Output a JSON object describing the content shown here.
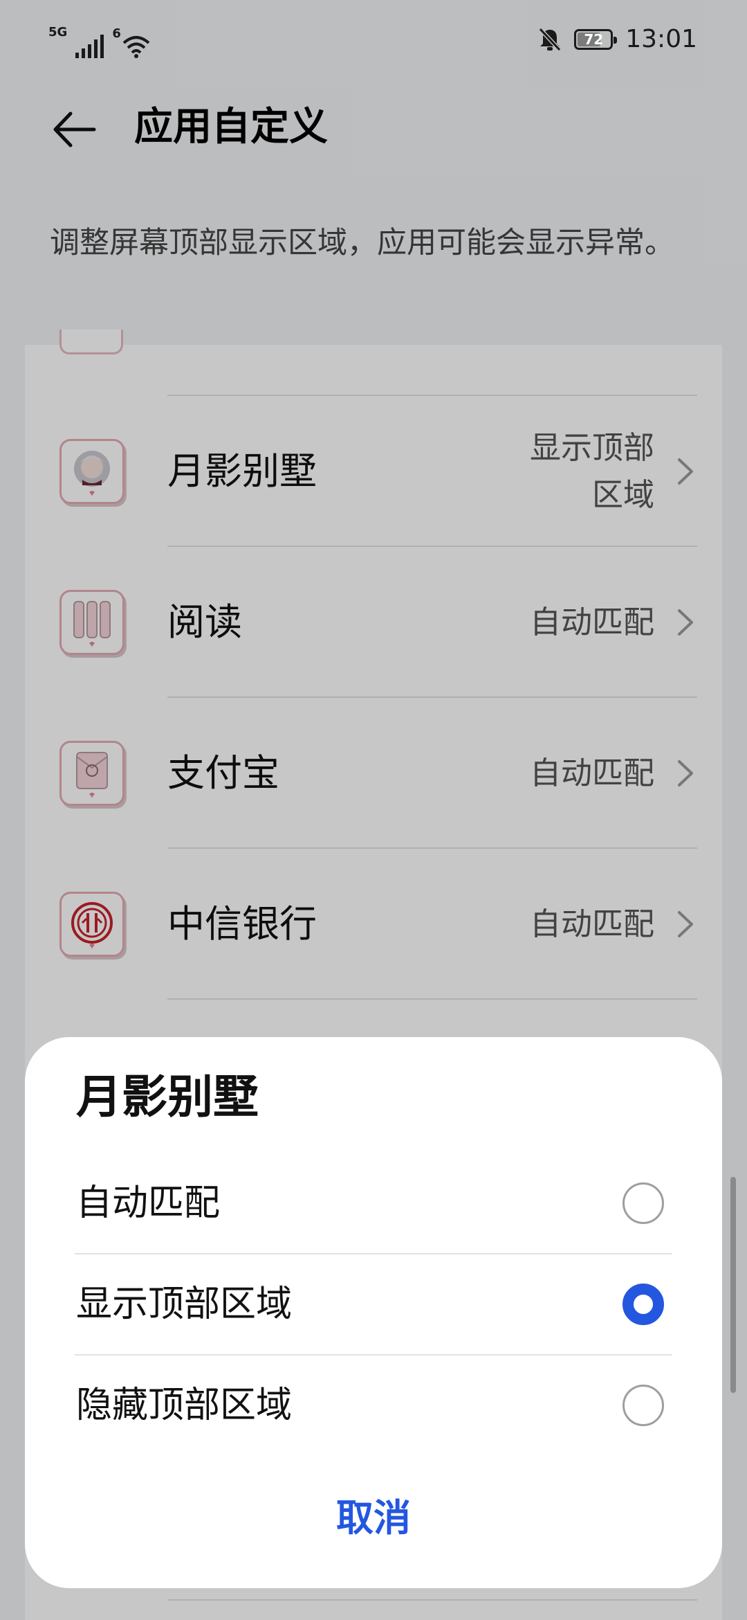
{
  "status_bar": {
    "network_type": "5G",
    "wifi_label": "6",
    "battery_level": "72",
    "battery_fraction": 0.72,
    "time": "13:01"
  },
  "header": {
    "title": "应用自定义"
  },
  "description": "调整屏幕顶部显示区域，应用可能会显示异常。",
  "apps": [
    {
      "name": "月影别墅",
      "setting_line1": "显示顶部",
      "setting_line2": "区域",
      "icon": "avatar-app-icon"
    },
    {
      "name": "阅读",
      "setting_line1": "自动匹配",
      "setting_line2": "",
      "icon": "books-app-icon"
    },
    {
      "name": "支付宝",
      "setting_line1": "自动匹配",
      "setting_line2": "",
      "icon": "wallet-app-icon"
    },
    {
      "name": "中信银行",
      "setting_line1": "自动匹配",
      "setting_line2": "",
      "icon": "bank-app-icon"
    }
  ],
  "dialog": {
    "title": "月影别墅",
    "options": [
      {
        "label": "自动匹配",
        "selected": false
      },
      {
        "label": "显示顶部区域",
        "selected": true
      },
      {
        "label": "隐藏顶部区域",
        "selected": false
      }
    ],
    "cancel_label": "取消"
  },
  "colors": {
    "accent": "#2457e0",
    "icon_border": "#e6a9b4"
  }
}
